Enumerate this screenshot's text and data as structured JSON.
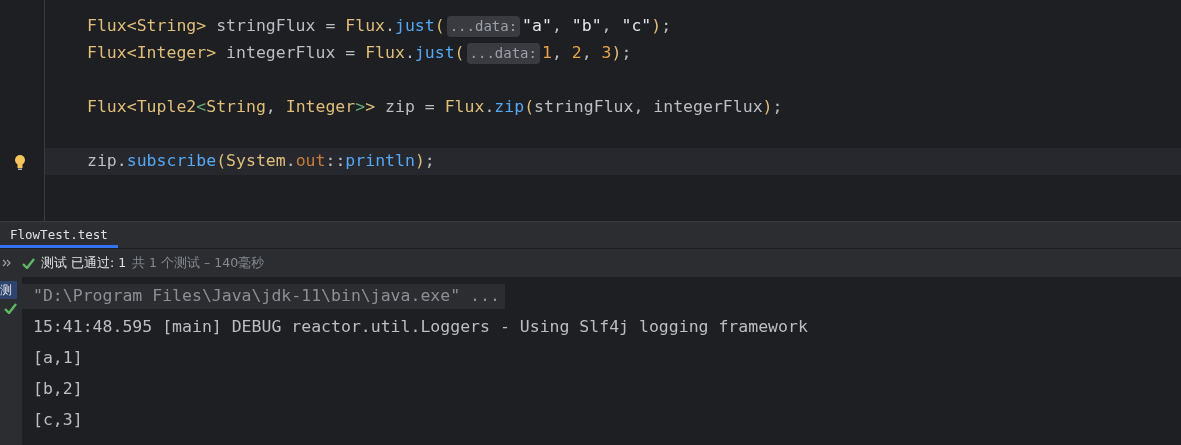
{
  "editor": {
    "lines": [
      {
        "tokens": [
          {
            "kind": "type",
            "text": "Flux<String>"
          },
          {
            "kind": "plain",
            "text": " stringFlux = "
          },
          {
            "kind": "type",
            "text": "Flux"
          },
          {
            "kind": "plain",
            "text": "."
          },
          {
            "kind": "method",
            "text": "just"
          },
          {
            "kind": "paren",
            "text": "("
          },
          {
            "kind": "hint",
            "text": "...data:"
          },
          {
            "kind": "string",
            "text": "\"a\""
          },
          {
            "kind": "plain",
            "text": ", "
          },
          {
            "kind": "string",
            "text": "\"b\""
          },
          {
            "kind": "plain",
            "text": ", "
          },
          {
            "kind": "string",
            "text": "\"c\""
          },
          {
            "kind": "paren",
            "text": ")"
          },
          {
            "kind": "plain",
            "text": ";"
          }
        ]
      },
      {
        "tokens": [
          {
            "kind": "type",
            "text": "Flux<Integer>"
          },
          {
            "kind": "plain",
            "text": " integerFlux = "
          },
          {
            "kind": "type",
            "text": "Flux"
          },
          {
            "kind": "plain",
            "text": "."
          },
          {
            "kind": "method",
            "text": "just"
          },
          {
            "kind": "paren",
            "text": "("
          },
          {
            "kind": "hint",
            "text": "...data:"
          },
          {
            "kind": "number",
            "text": "1"
          },
          {
            "kind": "plain",
            "text": ", "
          },
          {
            "kind": "number",
            "text": "2"
          },
          {
            "kind": "plain",
            "text": ", "
          },
          {
            "kind": "number",
            "text": "3"
          },
          {
            "kind": "paren",
            "text": ")"
          },
          {
            "kind": "plain",
            "text": ";"
          }
        ]
      },
      {
        "gap_before": true,
        "tokens": [
          {
            "kind": "type",
            "text": "Flux<Tuple2"
          },
          {
            "kind": "generic",
            "text": "<"
          },
          {
            "kind": "type",
            "text": "String"
          },
          {
            "kind": "plain",
            "text": ", "
          },
          {
            "kind": "type",
            "text": "Integer"
          },
          {
            "kind": "generic",
            "text": ">"
          },
          {
            "kind": "type",
            "text": ">"
          },
          {
            "kind": "plain",
            "text": " zip = "
          },
          {
            "kind": "type",
            "text": "Flux"
          },
          {
            "kind": "plain",
            "text": "."
          },
          {
            "kind": "method",
            "text": "zip"
          },
          {
            "kind": "paren",
            "text": "("
          },
          {
            "kind": "plain",
            "text": "stringFlux, integerFlux"
          },
          {
            "kind": "paren",
            "text": ")"
          },
          {
            "kind": "plain",
            "text": ";"
          }
        ]
      },
      {
        "gap_before": true,
        "current": true,
        "bulb": true,
        "tokens": [
          {
            "kind": "plain",
            "text": "zip."
          },
          {
            "kind": "method",
            "text": "subscribe"
          },
          {
            "kind": "paren",
            "text": "("
          },
          {
            "kind": "type",
            "text": "System"
          },
          {
            "kind": "plain",
            "text": "."
          },
          {
            "kind": "field",
            "text": "out"
          },
          {
            "kind": "plain",
            "text": "::"
          },
          {
            "kind": "method",
            "text": "println"
          },
          {
            "kind": "paren",
            "text": ")"
          },
          {
            "kind": "plain",
            "text": ";"
          }
        ]
      }
    ]
  },
  "run_panel": {
    "tabs": [
      {
        "label": "FlowTest.test",
        "selected": true
      }
    ],
    "status": {
      "passed": "测试 已通过: 1",
      "summary": "共 1 个测试 – 140毫秒"
    },
    "tree_item": "测",
    "console": [
      {
        "kind": "command",
        "text": "\"D:\\Program Files\\Java\\jdk-11\\bin\\java.exe\" ..."
      },
      {
        "kind": "output",
        "text": "15:41:48.595 [main] DEBUG reactor.util.Loggers - Using Slf4j logging framework"
      },
      {
        "kind": "output",
        "text": "[a,1]"
      },
      {
        "kind": "output",
        "text": "[b,2]"
      },
      {
        "kind": "output",
        "text": "[c,3]"
      }
    ]
  }
}
